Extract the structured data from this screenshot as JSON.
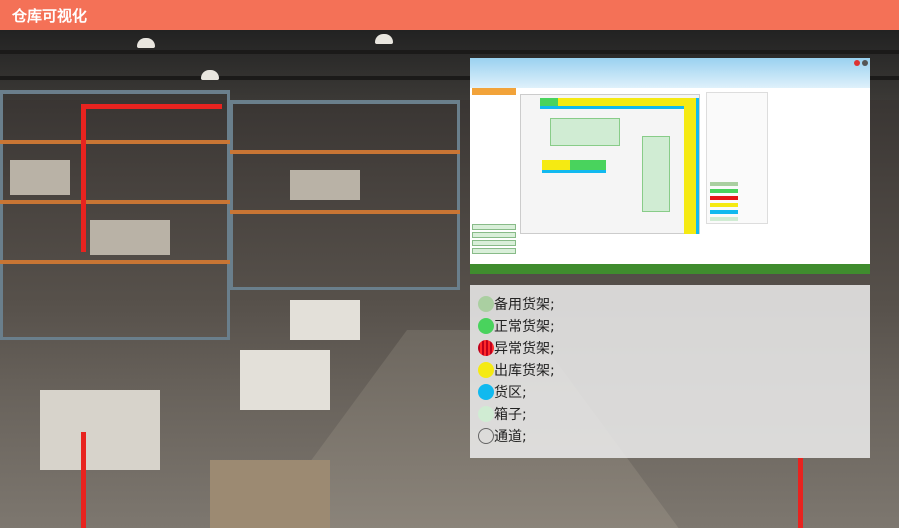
{
  "header": {
    "title": "仓库可视化"
  },
  "colors": {
    "header_bg": "#f47157",
    "corner_marker": "#e8231f",
    "panel_bg": "rgba(236,236,236,0.86)"
  },
  "legend": [
    {
      "label": "备用货架;",
      "color": "#aacfa1",
      "style": "solid"
    },
    {
      "label": "正常货架;",
      "color": "#49d35d",
      "style": "solid"
    },
    {
      "label": "异常货架;",
      "color": "#e51616",
      "style": "striped"
    },
    {
      "label": "出库货架;",
      "color": "#f5ea12",
      "style": "solid"
    },
    {
      "label": "货区;",
      "color": "#11b9ef",
      "style": "solid"
    },
    {
      "label": "箱子;",
      "color": "#d0ecd3",
      "style": "solid"
    },
    {
      "label": "通道;",
      "color": "transparent",
      "style": "outline"
    }
  ],
  "thumbnail": {
    "icon": "warehouse-map-screenshot"
  }
}
